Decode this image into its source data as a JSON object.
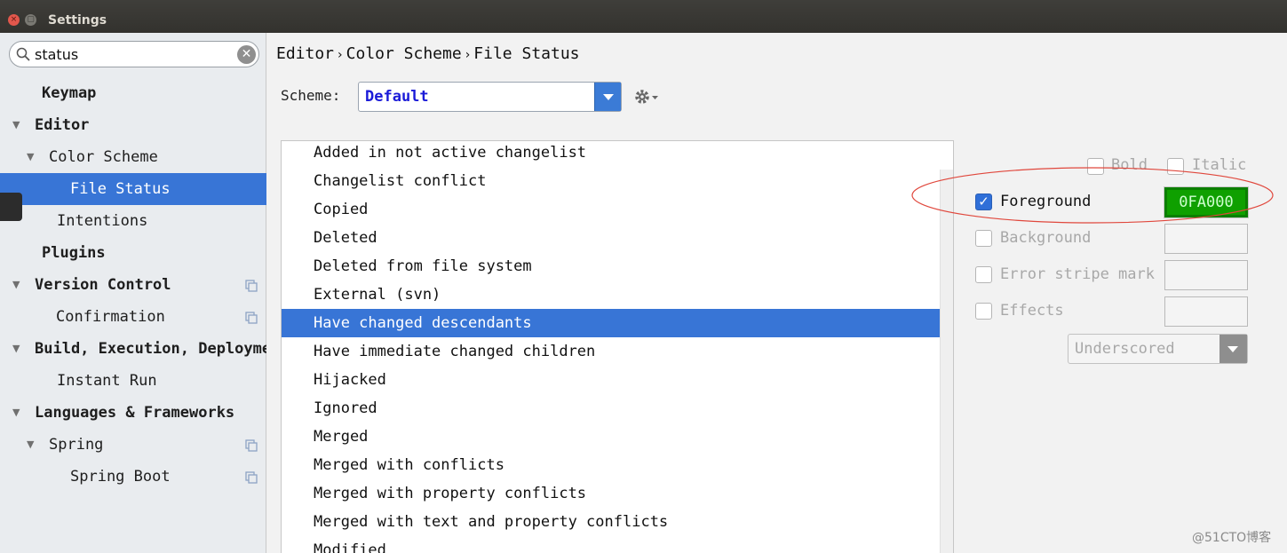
{
  "window": {
    "title": "Settings",
    "close_glyph": "×",
    "minimize_glyph": "▢"
  },
  "search": {
    "value": "status"
  },
  "sidebar": {
    "items": [
      {
        "label": "Keymap",
        "arrow": ""
      },
      {
        "label": "Editor",
        "arrow": "▼"
      },
      {
        "label": "Color Scheme",
        "arrow": "▼"
      },
      {
        "label": "File Status",
        "arrow": ""
      },
      {
        "label": "Intentions",
        "arrow": ""
      },
      {
        "label": "Plugins",
        "arrow": ""
      },
      {
        "label": "Version Control",
        "arrow": "▼"
      },
      {
        "label": "Confirmation",
        "arrow": ""
      },
      {
        "label": "Build, Execution, Deployment",
        "arrow": "▼"
      },
      {
        "label": "Instant Run",
        "arrow": ""
      },
      {
        "label": "Languages & Frameworks",
        "arrow": "▼"
      },
      {
        "label": "Spring",
        "arrow": "▼"
      },
      {
        "label": "Spring Boot",
        "arrow": ""
      }
    ]
  },
  "breadcrumb": {
    "part1": "Editor",
    "part2": "Color Scheme",
    "part3": "File Status",
    "sep": "›"
  },
  "scheme": {
    "label": "Scheme:",
    "value": "Default"
  },
  "status_list": [
    "Added in not active changelist",
    "Changelist conflict",
    "Copied",
    "Deleted",
    "Deleted from file system",
    "External (svn)",
    "Have changed descendants",
    "Have immediate changed children",
    "Hijacked",
    "Ignored",
    "Merged",
    "Merged with conflicts",
    "Merged with property conflicts",
    "Merged with text and property conflicts",
    "Modified"
  ],
  "options": {
    "bold": "Bold",
    "italic": "Italic",
    "foreground": "Foreground",
    "foreground_value": "0FA000",
    "check_glyph": "✓",
    "background": "Background",
    "error_stripe": "Error stripe mark",
    "effects": "Effects",
    "effect_type": "Underscored"
  },
  "colors": {
    "selection": "#3875d6",
    "foreground_swatch": "#0fa000",
    "annotation": "#e0473c"
  },
  "watermark": "@51CTO博客"
}
